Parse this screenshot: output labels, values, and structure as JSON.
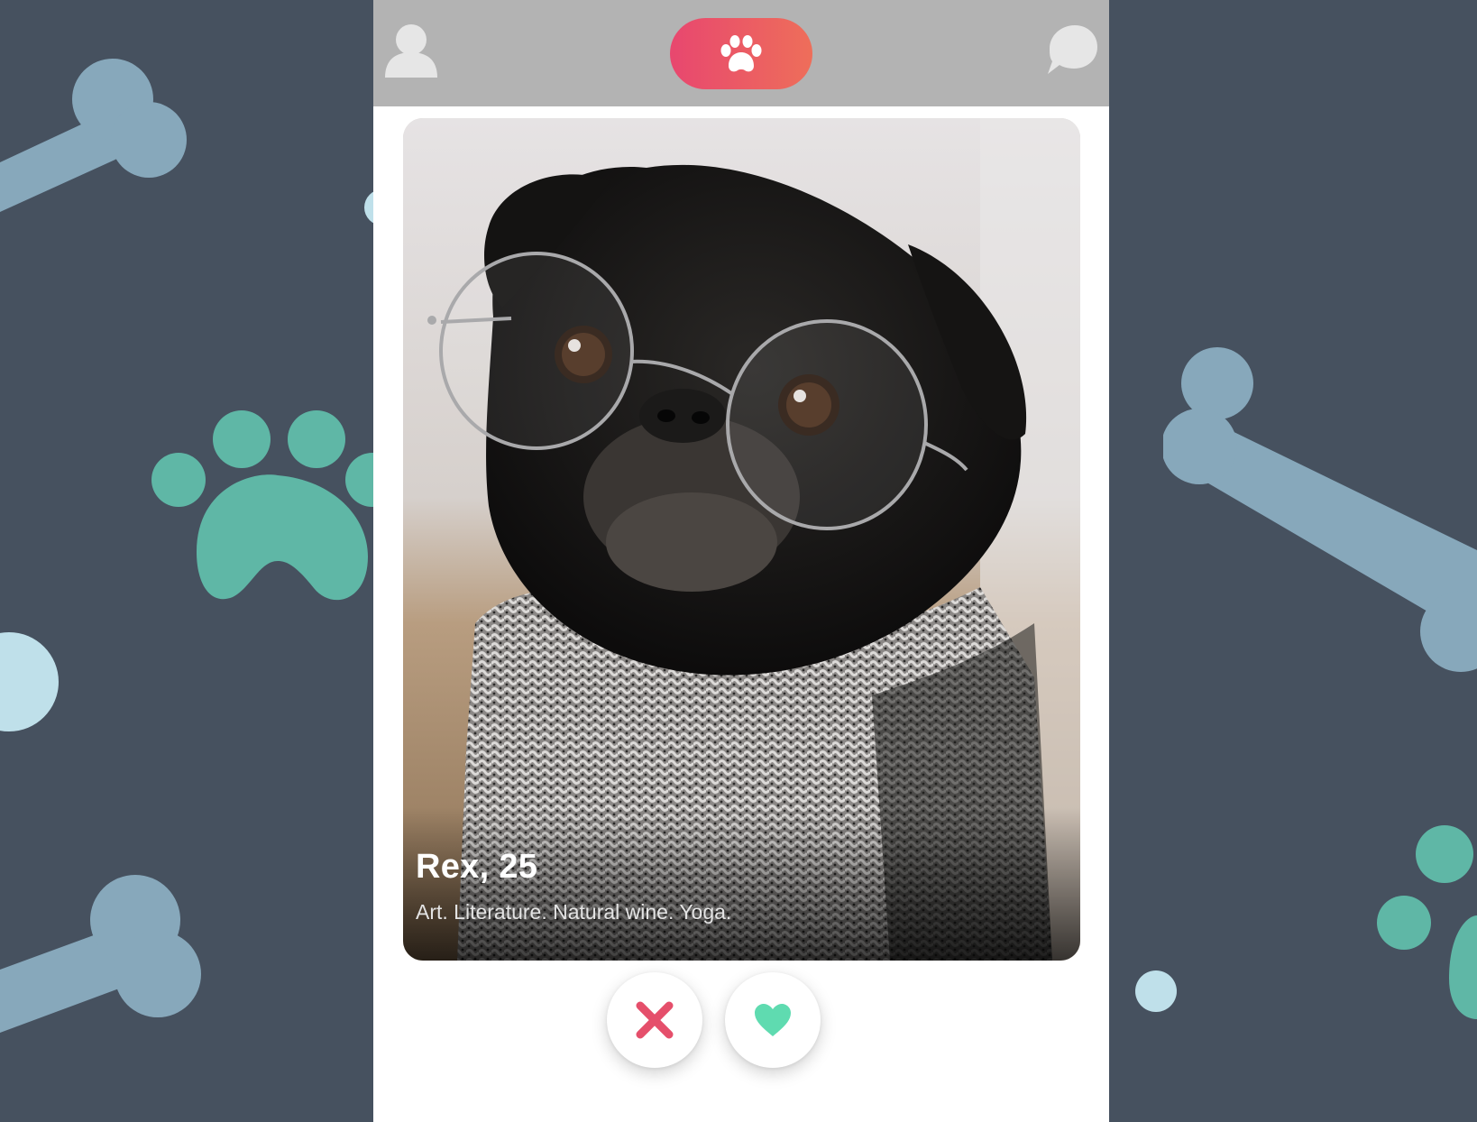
{
  "app": {
    "colors": {
      "background": "#46515f",
      "topbar": "#b3b3b3",
      "accent_start": "#e8476f",
      "accent_end": "#ee6e5a",
      "like": "#5fdbb0",
      "dislike": "#e54f6b"
    }
  },
  "topbar": {
    "profile_icon": "user-silhouette-icon",
    "center_icon": "paw-icon",
    "messages_icon": "chat-bubble-icon"
  },
  "profile_card": {
    "name_age": "Rex, 25",
    "bio": "Art. Literature. Natural wine. Yoga.",
    "photo": "black pug wearing round glasses and a knit scarf"
  },
  "actions": {
    "dislike_icon": "close-x-icon",
    "like_icon": "heart-icon"
  }
}
